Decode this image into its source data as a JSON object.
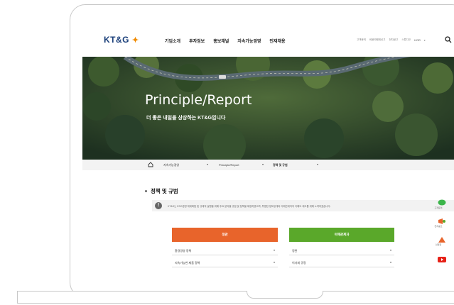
{
  "brand": {
    "logo_text": "KT&G"
  },
  "nav": {
    "items": [
      "기업소개",
      "투자정보",
      "홍보채널",
      "지속가능경영",
      "인재채용"
    ]
  },
  "utility": {
    "links": [
      "고객문의",
      "비윤리행위신고",
      "전자공고",
      "스튜디오"
    ],
    "lang": "KOR"
  },
  "hero": {
    "title": "Principle/Report",
    "subtitle": "더 좋은 내일을 상상하는 KT&G입니다"
  },
  "breadcrumb": {
    "items": [
      "지속가능경영",
      "Principle/Report",
      "정책 및 규범"
    ]
  },
  "content": {
    "section_title": "정책 및 규범",
    "notice": "KT&G는 ESG경영 체계확립 및 규제적 실행을 위해 주요 분야별 규범 및 정책을 제정하였으며, 투명한 정보공개와 이해관계자의 이해도 제고를 위해 노력하겠습니다.",
    "button_left": "정관",
    "button_right": "이해관계자",
    "left_selects": [
      "환경경영 정책",
      "지속가능한 제품 정책"
    ],
    "right_selects": [
      "정관",
      "이사회 규정"
    ]
  },
  "quick_menu": {
    "items": [
      "고객문의",
      "전자공고",
      "인천항",
      "유튜브"
    ]
  },
  "colors": {
    "orange": "#e8642b",
    "green": "#5aa82a",
    "brand_blue": "#1a3f7a"
  }
}
